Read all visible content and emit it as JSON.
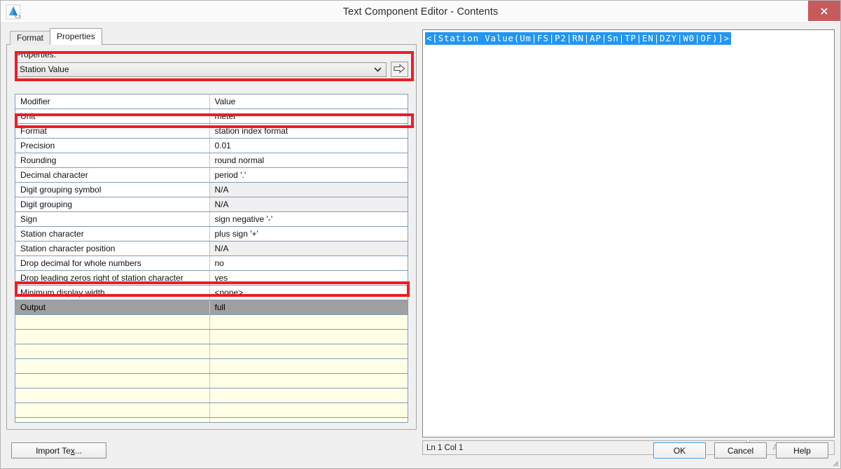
{
  "window": {
    "title": "Text Component Editor - Contents",
    "app_icon": "autocad-civil3d-icon",
    "close_icon": "close-icon",
    "close_color": "#c75b5b"
  },
  "tabs": [
    {
      "label": "Format",
      "active": false
    },
    {
      "label": "Properties",
      "active": true
    }
  ],
  "properties_group": {
    "label": "Properties:",
    "selected_value": "Station Value",
    "dropdown_icon": "chevron-down-icon",
    "insert_icon": "arrow-right-icon"
  },
  "grid": {
    "columns": [
      "Modifier",
      "Value"
    ],
    "rows": [
      {
        "modifier": "Unit",
        "value": "meter",
        "na": false,
        "selected": false
      },
      {
        "modifier": "Format",
        "value": "station index format",
        "na": false,
        "selected": false
      },
      {
        "modifier": "Precision",
        "value": "0.01",
        "na": false,
        "selected": false
      },
      {
        "modifier": "Rounding",
        "value": "round normal",
        "na": false,
        "selected": false
      },
      {
        "modifier": "Decimal character",
        "value": "period '.'",
        "na": false,
        "selected": false
      },
      {
        "modifier": "Digit grouping symbol",
        "value": "N/A",
        "na": true,
        "selected": false
      },
      {
        "modifier": "Digit grouping",
        "value": "N/A",
        "na": true,
        "selected": false
      },
      {
        "modifier": "Sign",
        "value": "sign negative '-'",
        "na": false,
        "selected": false
      },
      {
        "modifier": "Station character",
        "value": "plus sign '+'",
        "na": false,
        "selected": false
      },
      {
        "modifier": "Station character position",
        "value": "N/A",
        "na": true,
        "selected": false
      },
      {
        "modifier": "Drop decimal for whole numbers",
        "value": "no",
        "na": false,
        "selected": false
      },
      {
        "modifier": "Drop leading zeros right of station character",
        "value": "yes",
        "na": false,
        "selected": false
      },
      {
        "modifier": "Minimum display width",
        "value": "<none>",
        "na": false,
        "selected": false
      },
      {
        "modifier": "Output",
        "value": "full",
        "na": false,
        "selected": true
      }
    ],
    "empty_row_count": 10
  },
  "editor": {
    "code": "<[Station Value(Um|FS|P2|RN|AP|Sn|TP|EN|DZY|W0|OF)]>",
    "selection_color": "#2196f3",
    "status_position": "Ln 1 Col 1",
    "autocaps_label": "AutoCAPS"
  },
  "footer": {
    "import_prefix": "Import Te",
    "import_accel": "x",
    "import_suffix": "...",
    "ok_label": "OK",
    "cancel_label": "Cancel",
    "help_label": "Help"
  },
  "annotations": {
    "color": "#ee1c25",
    "boxes": [
      "properties-selector",
      "format-row",
      "output-row"
    ]
  }
}
